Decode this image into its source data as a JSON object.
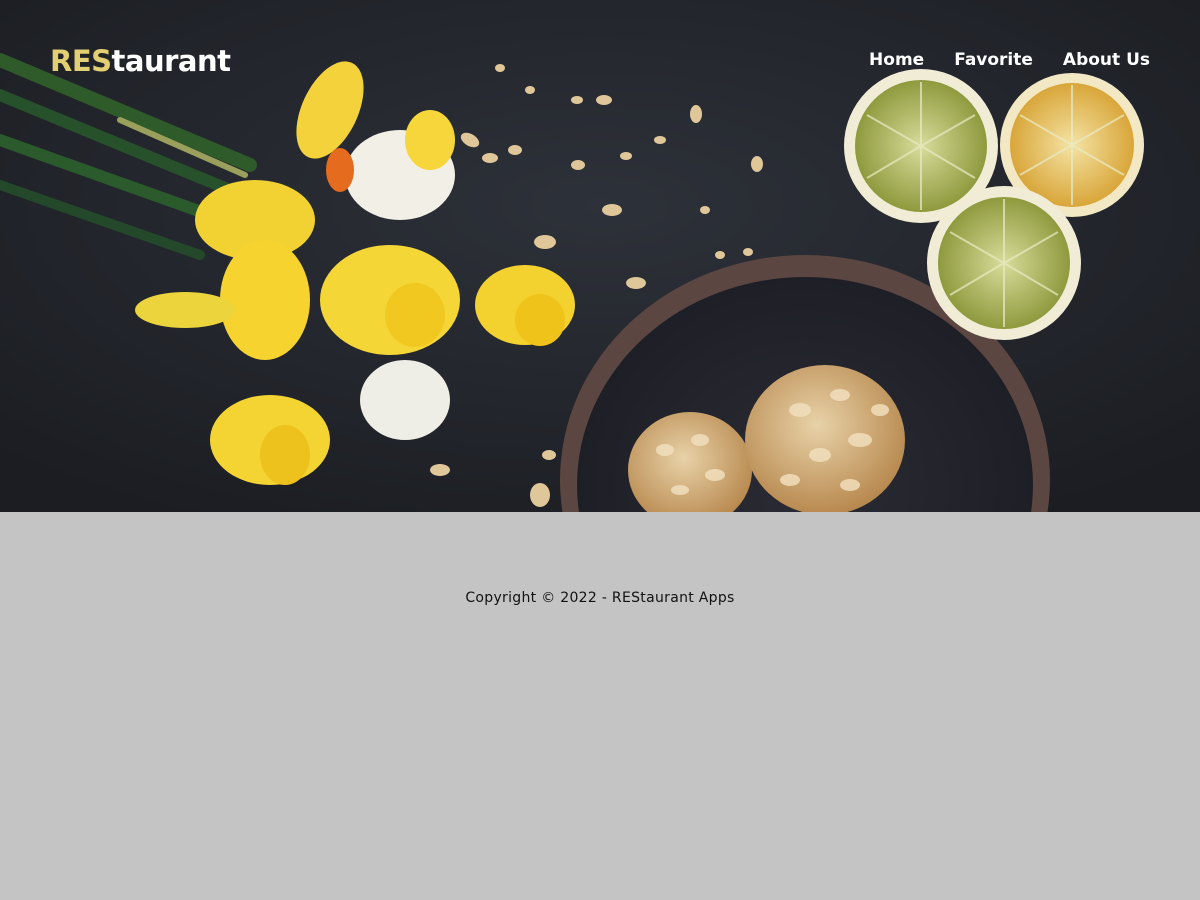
{
  "header": {
    "brand_accent": "RES",
    "brand_rest": "taurant",
    "nav": [
      {
        "label": "Home"
      },
      {
        "label": "Favorite"
      },
      {
        "label": "About Us"
      }
    ]
  },
  "hero": {
    "image": "flowers-lemons-cookies-photo"
  },
  "footer": {
    "copyright": "Copyright © 2022 - REStaurant Apps"
  },
  "colors": {
    "brand_accent": "#e3cf73",
    "hero_bg": "#23262c",
    "footer_bg": "#c4c4c4"
  }
}
